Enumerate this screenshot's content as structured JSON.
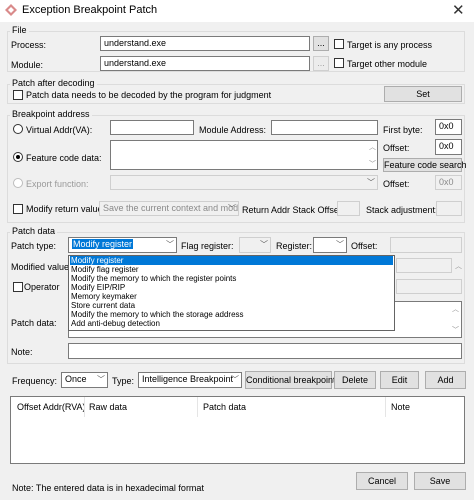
{
  "window": {
    "title": "Exception Breakpoint Patch",
    "close_glyph": "✕"
  },
  "file": {
    "group": "File",
    "process_label": "Process:",
    "process_value": "understand.exe",
    "process_browse": "...",
    "process_any_label": "Target is any process",
    "module_label": "Module:",
    "module_value": "understand.exe",
    "module_browse": "...",
    "module_other_label": "Target other module"
  },
  "patch_after": {
    "group": "Patch after decoding",
    "checkbox_label": "Patch data needs to be decoded by the program for judgment",
    "set_button": "Set"
  },
  "breakpoint": {
    "group": "Breakpoint address",
    "virtual_addr_label": "Virtual Addr(VA):",
    "module_address_label": "Module Address:",
    "first_byte_label": "First byte:",
    "first_byte_value": "0x0",
    "feature_code_label": "Feature code data:",
    "offset_label": "Offset:",
    "offset_value": "0x0",
    "feature_search_button": "Feature code search",
    "export_function_label": "Export function:",
    "export_offset_label": "Offset:",
    "export_offset_value": "0x0",
    "modify_return_label": "Modify return value:",
    "modify_return_combo": "Save the current context and modif",
    "return_stack_label": "Return Addr Stack Offset:",
    "stack_adjust_label": "Stack adjustment:"
  },
  "patch": {
    "group": "Patch data",
    "patch_type_label": "Patch type:",
    "patch_type_value": "Modify register",
    "flag_register_label": "Flag register:",
    "register_label": "Register:",
    "offset_label": "Offset:",
    "modified_value_label": "Modified value:",
    "operator_label": "Operator",
    "patch_data_label": "Patch data:",
    "note_label": "Note:",
    "dropdown_options": [
      "Modify register",
      "Modify flag register",
      "Modify the memory to which the register points",
      "Modify EIP/RIP",
      "Memory keymaker",
      "Store current data",
      "Modify the memory to which the storage address",
      "Add anti-debug detection"
    ]
  },
  "controls": {
    "frequency_label": "Frequency:",
    "frequency_value": "Once",
    "type_label": "Type:",
    "type_value": "Intelligence Breakpoint",
    "conditional_button": "Conditional breakpoints",
    "delete_button": "Delete",
    "edit_button": "Edit",
    "add_button": "Add"
  },
  "table": {
    "columns": [
      "Offset Addr(RVA)",
      "Raw data",
      "Patch data",
      "Note"
    ]
  },
  "footer": {
    "note": "Note: The entered data is in hexadecimal format",
    "cancel_button": "Cancel",
    "save_button": "Save"
  },
  "colors": {
    "selection": "#0078d7",
    "window_bg": "#f0f0f0"
  },
  "icons": {
    "title": "patch-app-icon",
    "chevron": "chevron-down-icon",
    "scroll_up": "scroll-up-icon",
    "scroll_down": "scroll-down-icon"
  }
}
